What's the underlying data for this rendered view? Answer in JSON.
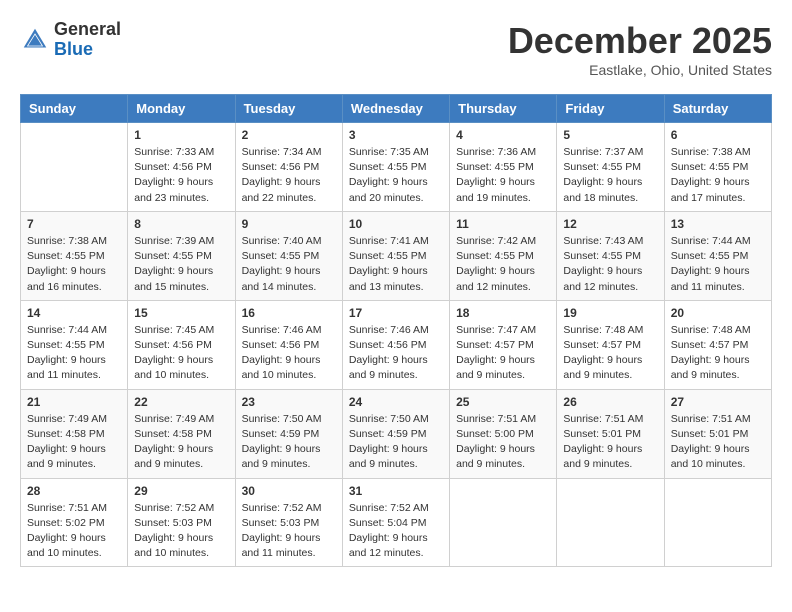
{
  "header": {
    "logo_general": "General",
    "logo_blue": "Blue",
    "month_title": "December 2025",
    "location": "Eastlake, Ohio, United States"
  },
  "days_of_week": [
    "Sunday",
    "Monday",
    "Tuesday",
    "Wednesday",
    "Thursday",
    "Friday",
    "Saturday"
  ],
  "weeks": [
    [
      {
        "day": "",
        "info": ""
      },
      {
        "day": "1",
        "info": "Sunrise: 7:33 AM\nSunset: 4:56 PM\nDaylight: 9 hours\nand 23 minutes."
      },
      {
        "day": "2",
        "info": "Sunrise: 7:34 AM\nSunset: 4:56 PM\nDaylight: 9 hours\nand 22 minutes."
      },
      {
        "day": "3",
        "info": "Sunrise: 7:35 AM\nSunset: 4:55 PM\nDaylight: 9 hours\nand 20 minutes."
      },
      {
        "day": "4",
        "info": "Sunrise: 7:36 AM\nSunset: 4:55 PM\nDaylight: 9 hours\nand 19 minutes."
      },
      {
        "day": "5",
        "info": "Sunrise: 7:37 AM\nSunset: 4:55 PM\nDaylight: 9 hours\nand 18 minutes."
      },
      {
        "day": "6",
        "info": "Sunrise: 7:38 AM\nSunset: 4:55 PM\nDaylight: 9 hours\nand 17 minutes."
      }
    ],
    [
      {
        "day": "7",
        "info": "Sunrise: 7:38 AM\nSunset: 4:55 PM\nDaylight: 9 hours\nand 16 minutes."
      },
      {
        "day": "8",
        "info": "Sunrise: 7:39 AM\nSunset: 4:55 PM\nDaylight: 9 hours\nand 15 minutes."
      },
      {
        "day": "9",
        "info": "Sunrise: 7:40 AM\nSunset: 4:55 PM\nDaylight: 9 hours\nand 14 minutes."
      },
      {
        "day": "10",
        "info": "Sunrise: 7:41 AM\nSunset: 4:55 PM\nDaylight: 9 hours\nand 13 minutes."
      },
      {
        "day": "11",
        "info": "Sunrise: 7:42 AM\nSunset: 4:55 PM\nDaylight: 9 hours\nand 12 minutes."
      },
      {
        "day": "12",
        "info": "Sunrise: 7:43 AM\nSunset: 4:55 PM\nDaylight: 9 hours\nand 12 minutes."
      },
      {
        "day": "13",
        "info": "Sunrise: 7:44 AM\nSunset: 4:55 PM\nDaylight: 9 hours\nand 11 minutes."
      }
    ],
    [
      {
        "day": "14",
        "info": "Sunrise: 7:44 AM\nSunset: 4:55 PM\nDaylight: 9 hours\nand 11 minutes."
      },
      {
        "day": "15",
        "info": "Sunrise: 7:45 AM\nSunset: 4:56 PM\nDaylight: 9 hours\nand 10 minutes."
      },
      {
        "day": "16",
        "info": "Sunrise: 7:46 AM\nSunset: 4:56 PM\nDaylight: 9 hours\nand 10 minutes."
      },
      {
        "day": "17",
        "info": "Sunrise: 7:46 AM\nSunset: 4:56 PM\nDaylight: 9 hours\nand 9 minutes."
      },
      {
        "day": "18",
        "info": "Sunrise: 7:47 AM\nSunset: 4:57 PM\nDaylight: 9 hours\nand 9 minutes."
      },
      {
        "day": "19",
        "info": "Sunrise: 7:48 AM\nSunset: 4:57 PM\nDaylight: 9 hours\nand 9 minutes."
      },
      {
        "day": "20",
        "info": "Sunrise: 7:48 AM\nSunset: 4:57 PM\nDaylight: 9 hours\nand 9 minutes."
      }
    ],
    [
      {
        "day": "21",
        "info": "Sunrise: 7:49 AM\nSunset: 4:58 PM\nDaylight: 9 hours\nand 9 minutes."
      },
      {
        "day": "22",
        "info": "Sunrise: 7:49 AM\nSunset: 4:58 PM\nDaylight: 9 hours\nand 9 minutes."
      },
      {
        "day": "23",
        "info": "Sunrise: 7:50 AM\nSunset: 4:59 PM\nDaylight: 9 hours\nand 9 minutes."
      },
      {
        "day": "24",
        "info": "Sunrise: 7:50 AM\nSunset: 4:59 PM\nDaylight: 9 hours\nand 9 minutes."
      },
      {
        "day": "25",
        "info": "Sunrise: 7:51 AM\nSunset: 5:00 PM\nDaylight: 9 hours\nand 9 minutes."
      },
      {
        "day": "26",
        "info": "Sunrise: 7:51 AM\nSunset: 5:01 PM\nDaylight: 9 hours\nand 9 minutes."
      },
      {
        "day": "27",
        "info": "Sunrise: 7:51 AM\nSunset: 5:01 PM\nDaylight: 9 hours\nand 10 minutes."
      }
    ],
    [
      {
        "day": "28",
        "info": "Sunrise: 7:51 AM\nSunset: 5:02 PM\nDaylight: 9 hours\nand 10 minutes."
      },
      {
        "day": "29",
        "info": "Sunrise: 7:52 AM\nSunset: 5:03 PM\nDaylight: 9 hours\nand 10 minutes."
      },
      {
        "day": "30",
        "info": "Sunrise: 7:52 AM\nSunset: 5:03 PM\nDaylight: 9 hours\nand 11 minutes."
      },
      {
        "day": "31",
        "info": "Sunrise: 7:52 AM\nSunset: 5:04 PM\nDaylight: 9 hours\nand 12 minutes."
      },
      {
        "day": "",
        "info": ""
      },
      {
        "day": "",
        "info": ""
      },
      {
        "day": "",
        "info": ""
      }
    ]
  ]
}
